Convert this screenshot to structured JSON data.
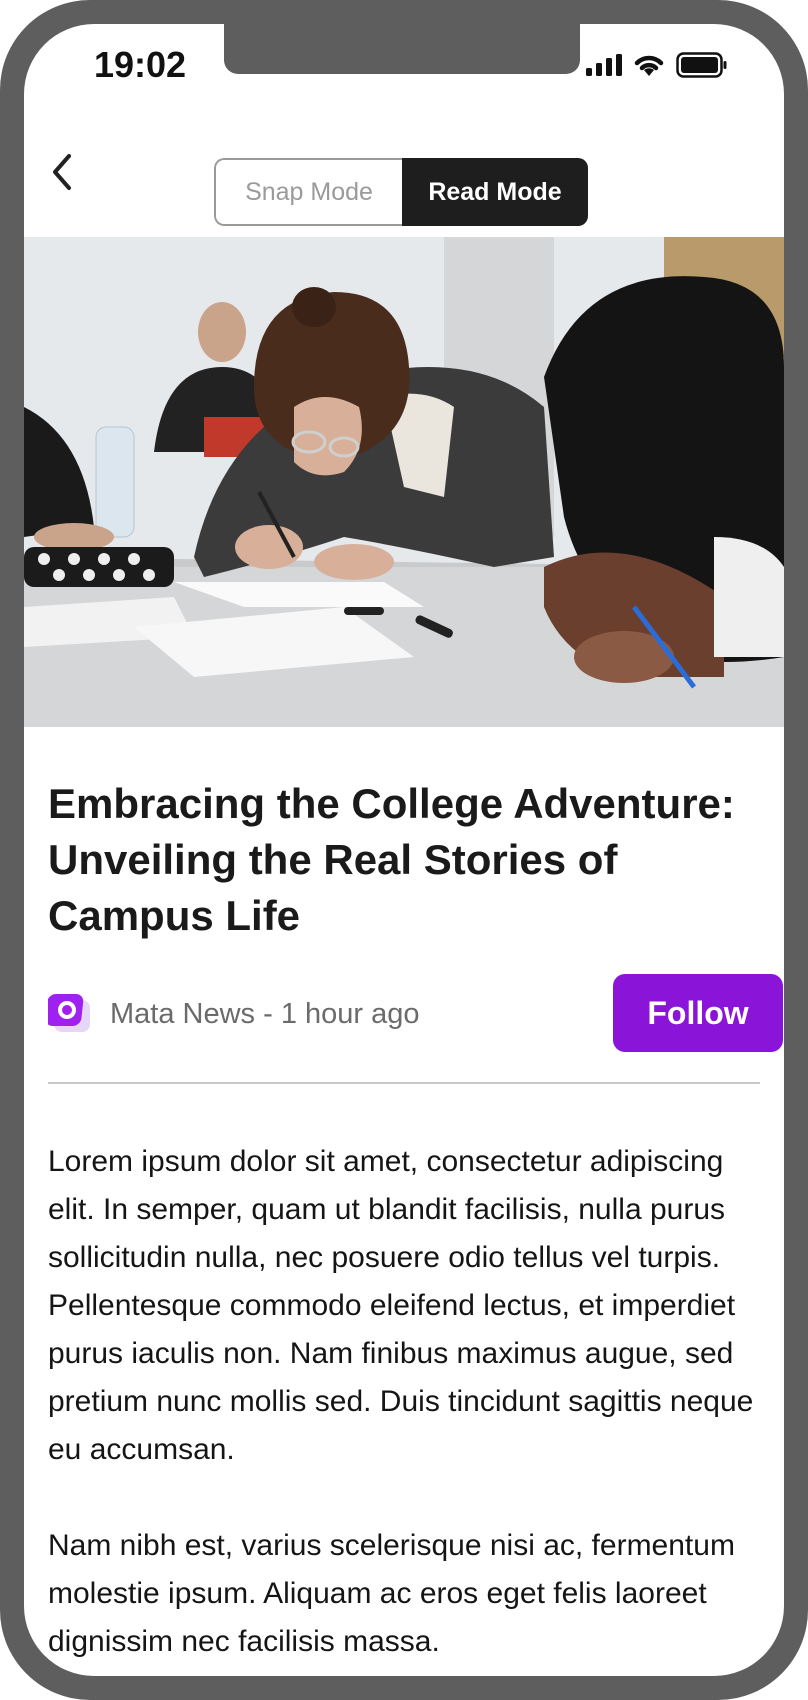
{
  "status_bar": {
    "time": "19:02",
    "icons": [
      "signal-icon",
      "wifi-icon",
      "battery-icon"
    ]
  },
  "nav": {
    "back_icon": "chevron-left-icon",
    "modes": [
      {
        "label": "Snap Mode",
        "selected": false
      },
      {
        "label": "Read Mode",
        "selected": true
      }
    ]
  },
  "article": {
    "title": "Embracing the College Adventure: Unveiling the Real Stories of Campus Life",
    "source": "Mata News - 1 hour ago",
    "follow_label": "Follow",
    "paragraphs": [
      "Lorem ipsum dolor sit amet, consectetur adipiscing elit. In semper, quam ut blandit facilisis, nulla purus sollicitudin nulla, nec posuere odio tellus vel turpis. Pellentesque commodo eleifend lectus, et imperdiet purus iaculis non. Nam finibus maximus augue, sed pretium nunc mollis sed. Duis tincidunt sagittis neque eu accumsan.",
      "Nam nibh est, varius scelerisque nisi ac, fermentum molestie ipsum. Aliquam ac eros eget felis laoreet dignissim nec facilisis massa."
    ]
  },
  "colors": {
    "accent": "#8a15d8",
    "frame": "#5e5e5e",
    "toggle_active": "#1e1e1e"
  }
}
